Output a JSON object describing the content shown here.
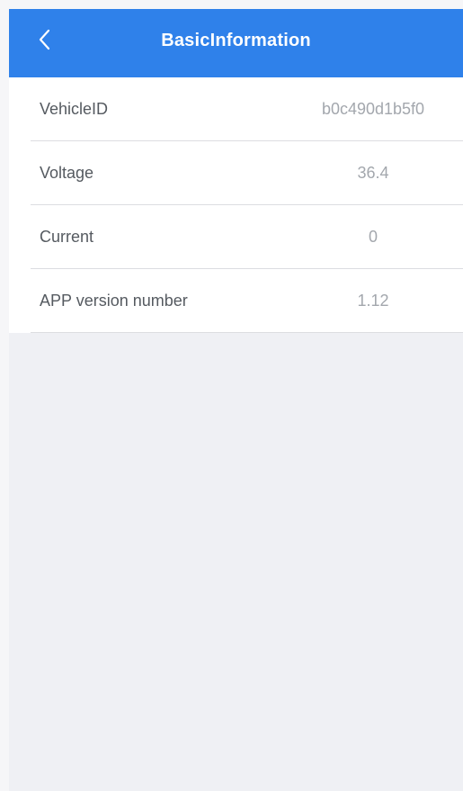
{
  "header": {
    "back_icon": "chevron-left-icon",
    "title": "BasicInformation",
    "background_color": "#2f81ea"
  },
  "info": {
    "rows": [
      {
        "label": "VehicleID",
        "value": "b0c490d1b5f0"
      },
      {
        "label": "Voltage",
        "value": "36.4"
      },
      {
        "label": "Current",
        "value": "0"
      },
      {
        "label": "APP version number",
        "value": "1.12"
      }
    ]
  }
}
